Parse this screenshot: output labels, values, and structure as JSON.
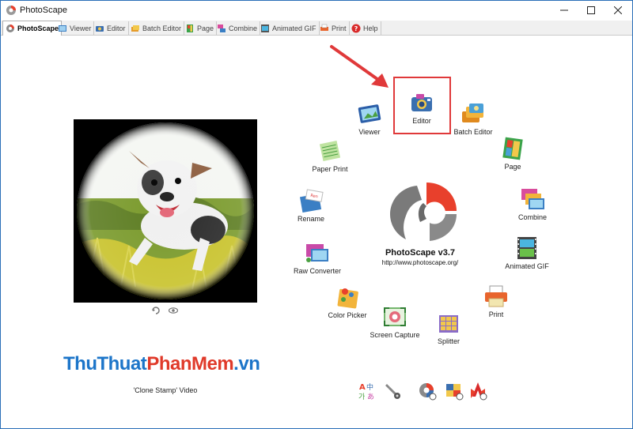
{
  "window": {
    "title": "PhotoScape"
  },
  "tabs": [
    {
      "label": "PhotoScape",
      "icon": "photoscape-icon",
      "active": true
    },
    {
      "label": "Viewer",
      "icon": "viewer-icon",
      "active": false
    },
    {
      "label": "Editor",
      "icon": "editor-icon",
      "active": false
    },
    {
      "label": "Batch Editor",
      "icon": "batch-editor-icon",
      "active": false
    },
    {
      "label": "Page",
      "icon": "page-icon",
      "active": false
    },
    {
      "label": "Combine",
      "icon": "combine-icon",
      "active": false
    },
    {
      "label": "Animated GIF",
      "icon": "animated-gif-icon",
      "active": false
    },
    {
      "label": "Print",
      "icon": "print-icon",
      "active": false
    },
    {
      "label": "Help",
      "icon": "help-icon",
      "active": false
    }
  ],
  "photo_panel": {
    "video_label": "'Clone Stamp' Video"
  },
  "watermark": {
    "part1": "ThuThuat",
    "part2": "PhanMem",
    "part3": ".vn"
  },
  "menu": {
    "viewer": "Viewer",
    "editor": "Editor",
    "batch_editor": "Batch Editor",
    "page": "Page",
    "paper_print": "Paper Print",
    "combine": "Combine",
    "rename": "Rename",
    "animated_gif": "Animated GIF",
    "raw_converter": "Raw Converter",
    "print": "Print",
    "color_picker": "Color Picker",
    "screen_capture": "Screen Capture",
    "splitter": "Splitter"
  },
  "logo": {
    "title": "PhotoScape v3.7",
    "url": "http://www.photoscape.org/"
  },
  "colors": {
    "highlight": "#e0393a",
    "logo_red": "#e8402c",
    "logo_gray": "#8a8a8a",
    "window_border": "#2a6fb8"
  },
  "bottom_toolbar": [
    "language-icon",
    "settings-tools-icon",
    "photoscape-update-icon",
    "photoscape-x-icon",
    "red-arrows-icon"
  ]
}
